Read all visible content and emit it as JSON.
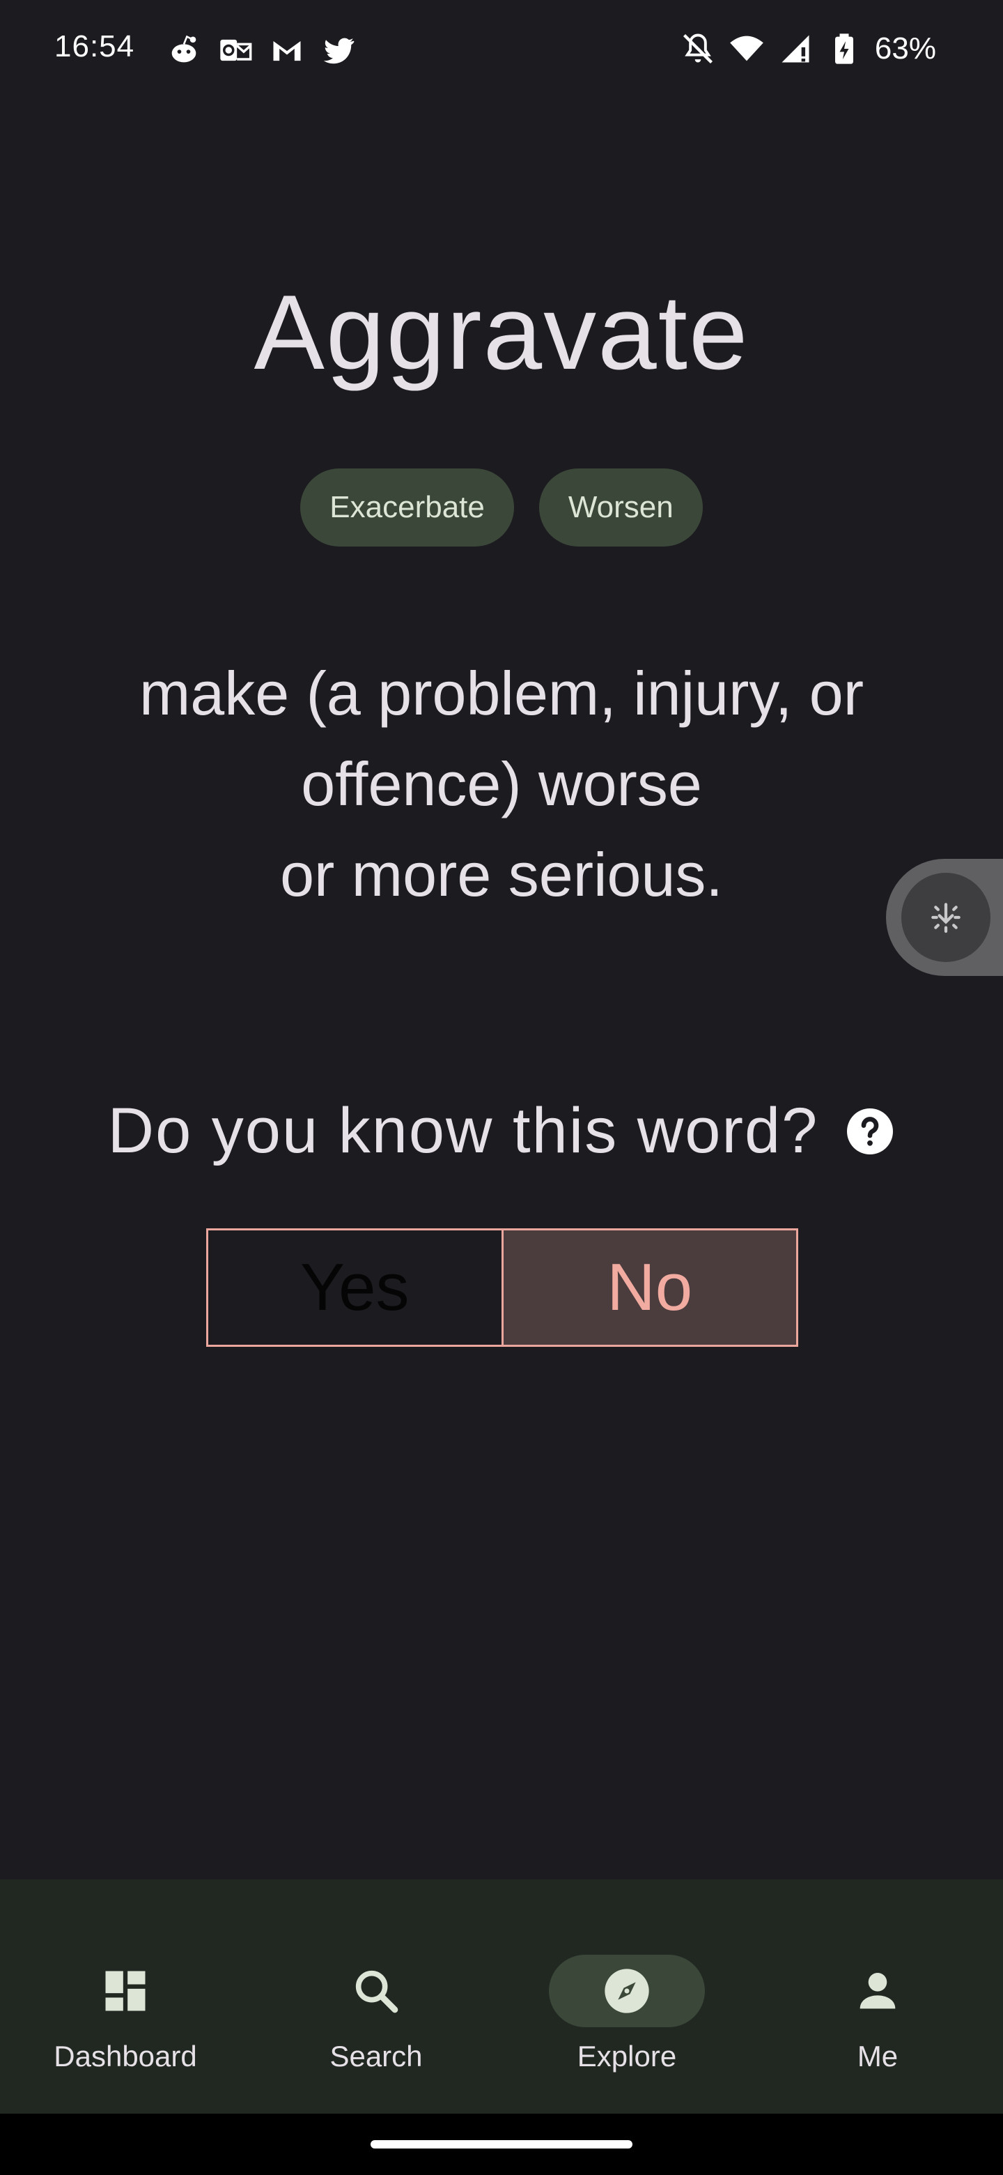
{
  "status_bar": {
    "time": "16:54",
    "notification_icons": [
      "reddit-icon",
      "outlook-icon",
      "gmail-icon",
      "twitter-icon"
    ],
    "system_icons": [
      "bell-off-icon",
      "wifi-icon",
      "signal-icon",
      "battery-charging-icon"
    ],
    "battery": "63%"
  },
  "word": {
    "title": "Aggravate",
    "synonyms": [
      "Exacerbate",
      "Worsen"
    ],
    "definition_lines": [
      "make (a problem, injury, or",
      "offence) worse",
      "or more serious."
    ]
  },
  "quiz": {
    "question": "Do you know this word?",
    "yes_label": "Yes",
    "no_label": "No",
    "selected": "No"
  },
  "bottom_nav": {
    "items": [
      {
        "label": "Dashboard",
        "icon": "dashboard-icon",
        "active": false
      },
      {
        "label": "Search",
        "icon": "search-icon",
        "active": false
      },
      {
        "label": "Explore",
        "icon": "compass-icon",
        "active": true
      },
      {
        "label": "Me",
        "icon": "person-icon",
        "active": false
      }
    ]
  },
  "colors": {
    "background": "#1c1b20",
    "chip": "#3b4839",
    "nav_background": "#212721",
    "answer_border": "#eba79d",
    "no_selected_bg": "#4b3d3e",
    "no_selected_text": "#f2aba1"
  }
}
